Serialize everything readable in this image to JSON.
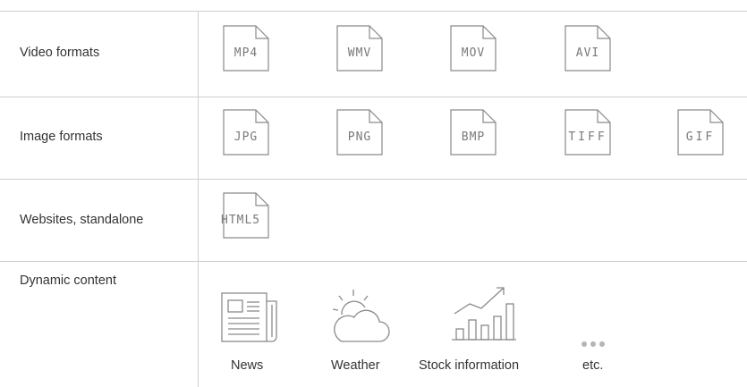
{
  "rows": [
    {
      "label": "Video formats",
      "files": [
        "MP4",
        "WMV",
        "MOV",
        "AVI"
      ]
    },
    {
      "label": "Image formats",
      "files": [
        "JPG",
        "PNG",
        "BMP",
        "TIFF",
        "GIF"
      ]
    },
    {
      "label": "Websites, standalone",
      "files": [
        "HTML5"
      ]
    },
    {
      "label": "Dynamic content",
      "items": [
        {
          "label": "News",
          "icon": "newspaper-icon"
        },
        {
          "label": "Weather",
          "icon": "sun-cloud-icon"
        },
        {
          "label": "Stock information",
          "icon": "stock-chart-icon"
        },
        {
          "label": "etc.",
          "icon": "more-dots-icon"
        }
      ]
    }
  ],
  "colors": {
    "line": "#cfcfcf",
    "icon": "#8a8a8a",
    "text": "#333333"
  }
}
